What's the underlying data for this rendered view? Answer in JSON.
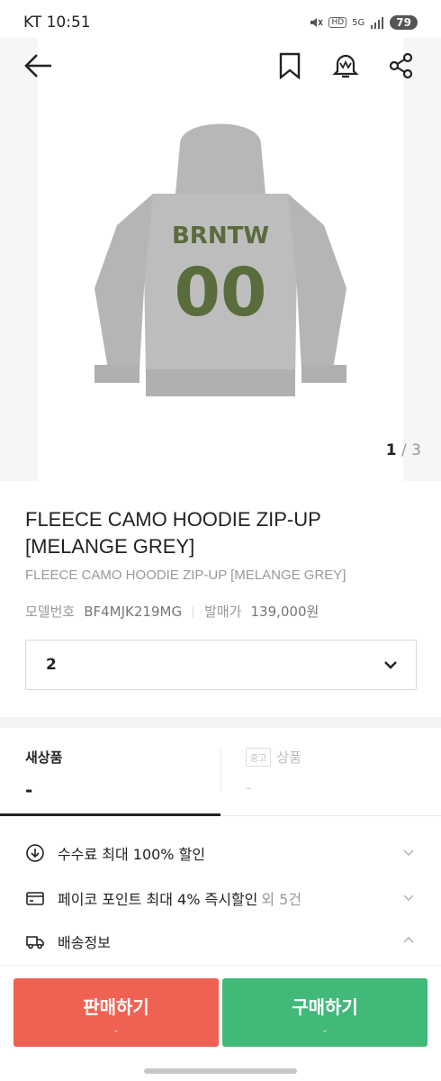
{
  "status_bar": {
    "carrier_time": "KT 10:51",
    "hd_label": "HD",
    "network_label": "5G",
    "battery": "79"
  },
  "gallery": {
    "current_page": "1",
    "separator": "/",
    "total_pages": "3",
    "print_text": "BRNTW",
    "number_text": "00"
  },
  "product": {
    "title": "FLEECE CAMO HOODIE ZIP-UP [MELANGE GREY]",
    "subtitle": "FLEECE CAMO HOODIE ZIP-UP [MELANGE GREY]",
    "model_label": "모델번호",
    "model_value": "BF4MJK219MG",
    "release_label": "발매가",
    "release_value": "139,000원"
  },
  "size_select": {
    "selected": "2"
  },
  "tabs": {
    "new_label": "새상품",
    "new_value": "-",
    "used_badge": "중고",
    "used_label": "상품",
    "used_value": "-"
  },
  "info_rows": [
    {
      "text": "수수료 최대 100% 할인",
      "suffix": "",
      "icon": "download-circle-icon"
    },
    {
      "text": "페이코 포인트 최대 4% 즉시할인",
      "suffix": "외 5건",
      "icon": "card-icon"
    },
    {
      "text": "배송정보",
      "suffix": "",
      "icon": "truck-icon"
    }
  ],
  "buttons": {
    "sell_label": "판매하기",
    "sell_sub": "-",
    "buy_label": "구매하기",
    "buy_sub": "-"
  },
  "colors": {
    "sell": "#ef6253",
    "buy": "#41b979",
    "camo": "#5a6b3c"
  }
}
